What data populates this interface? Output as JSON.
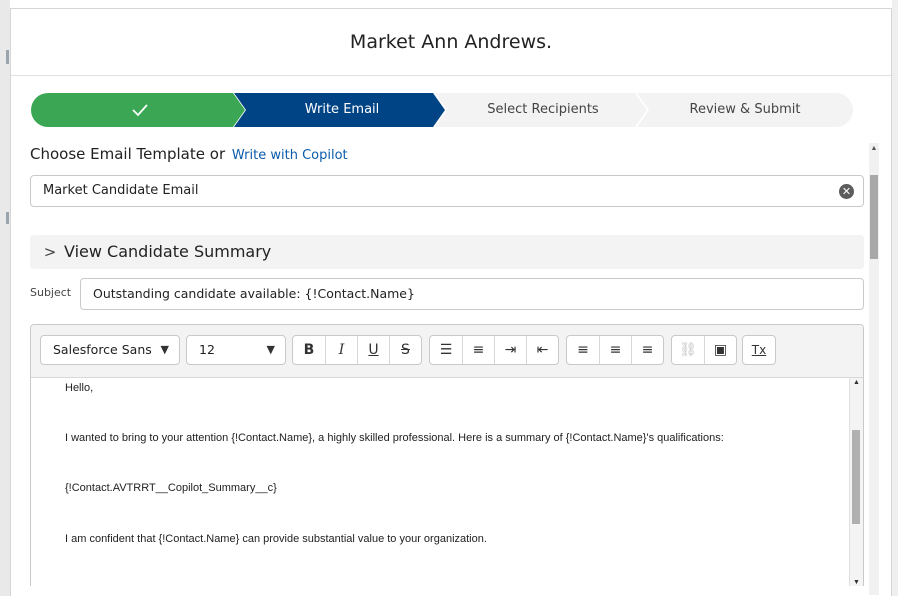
{
  "modal": {
    "title": "Market Ann Andrews."
  },
  "path": {
    "steps": [
      {
        "label": "",
        "state": "complete",
        "icon": "check-icon"
      },
      {
        "label": "Write Email",
        "state": "current"
      },
      {
        "label": "Select Recipients",
        "state": "upcoming"
      },
      {
        "label": "Review & Submit",
        "state": "upcoming"
      }
    ],
    "colors": {
      "complete": "#3ba755",
      "current": "#014486",
      "upcoming": "#f3f3f3",
      "upcoming_text": "#444444"
    }
  },
  "template": {
    "label": "Choose Email Template",
    "or_text": "or",
    "copilot_link": "Write with Copilot",
    "selected_value": "Market Candidate Email",
    "clear_icon": "clear-icon"
  },
  "summary_section": {
    "label": "View Candidate Summary",
    "icon": "chevron-right-icon"
  },
  "subject": {
    "label": "Subject",
    "value": "Outstanding candidate available: {!Contact.Name}"
  },
  "toolbar": {
    "font_family": "Salesforce Sans",
    "font_size": "12",
    "format_buttons": [
      {
        "name": "bold",
        "glyph": "B"
      },
      {
        "name": "italic",
        "glyph": "I"
      },
      {
        "name": "underline",
        "glyph": "U"
      },
      {
        "name": "strikethrough",
        "glyph": "S"
      }
    ],
    "list_buttons": [
      {
        "name": "bulleted-list",
        "glyph": "☰"
      },
      {
        "name": "numbered-list",
        "glyph": "≡"
      },
      {
        "name": "indent",
        "glyph": "⇥"
      },
      {
        "name": "outdent",
        "glyph": "⇤"
      }
    ],
    "align_buttons": [
      {
        "name": "align-left",
        "glyph": "≡"
      },
      {
        "name": "align-center",
        "glyph": "≡"
      },
      {
        "name": "align-right",
        "glyph": "≡"
      }
    ],
    "insert_buttons": [
      {
        "name": "link",
        "glyph": "⛓",
        "disabled": true
      },
      {
        "name": "image",
        "glyph": "▣",
        "disabled": false
      }
    ],
    "clear_format": {
      "name": "clear-formatting",
      "glyph": "Tx"
    }
  },
  "body": {
    "paragraphs": [
      "Hello,",
      "I wanted to bring to your attention {!Contact.Name}, a highly skilled professional. Here is a summary of {!Contact.Name}'s qualifications:",
      "{!Contact.AVTRRT__Copilot_Summary__c}",
      "I am confident that {!Contact.Name} can provide substantial value to your organization."
    ]
  }
}
